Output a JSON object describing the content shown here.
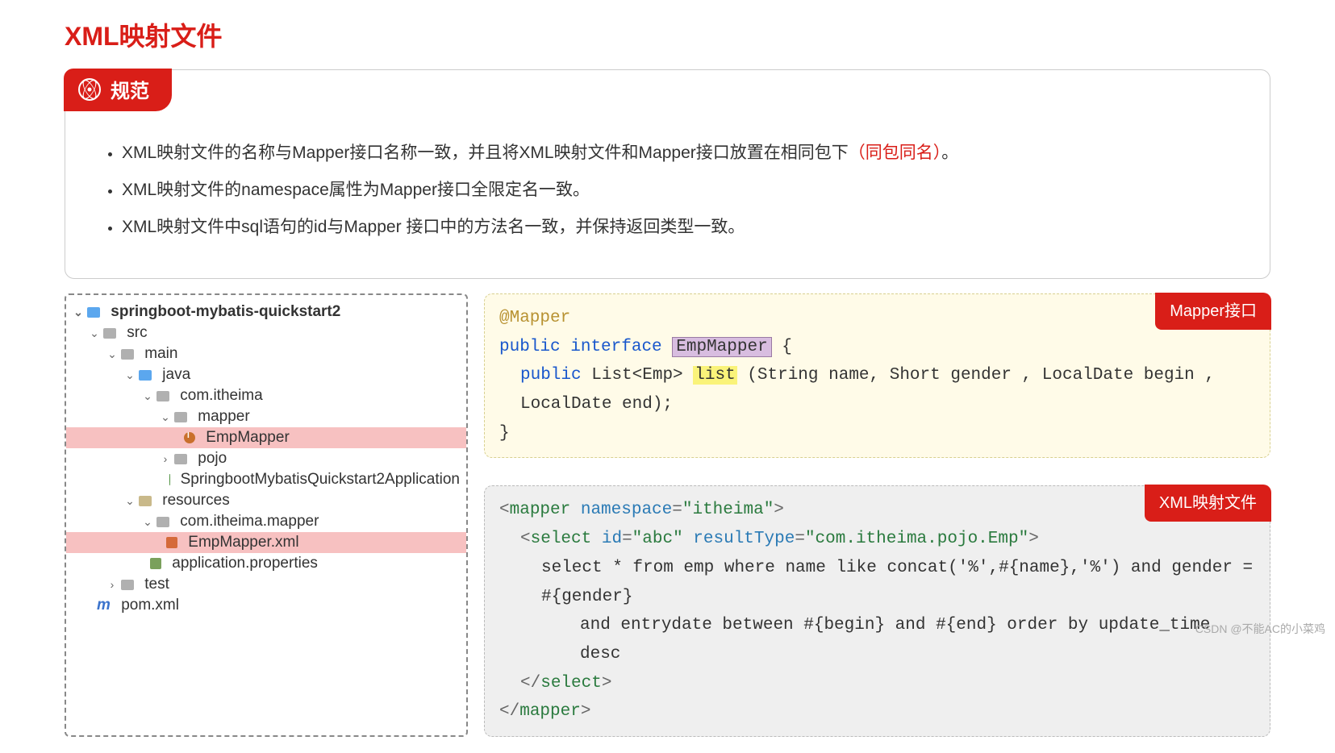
{
  "title": "XML映射文件",
  "badge_label": "规范",
  "rules": [
    {
      "pre": "XML映射文件的名称与Mapper接口名称一致，并且将XML映射文件和Mapper接口放置在相同包下",
      "red": "（同包同名）",
      "post": "。"
    },
    {
      "pre": "XML映射文件的namespace属性为Mapper接口全限定名一致。",
      "red": "",
      "post": ""
    },
    {
      "pre": "XML映射文件中sql语句的id与Mapper 接口中的方法名一致，并保持返回类型一致。",
      "red": "",
      "post": ""
    }
  ],
  "tree": {
    "root": "springboot-mybatis-quickstart2",
    "src": "src",
    "main": "main",
    "java": "java",
    "pkg": "com.itheima",
    "mapper_pkg": "mapper",
    "empMapper": "EmpMapper",
    "pojo": "pojo",
    "app": "SpringbootMybatisQuickstart2Application",
    "resources": "resources",
    "res_pkg": "com.itheima.mapper",
    "empXml": "EmpMapper.xml",
    "props": "application.properties",
    "test": "test",
    "pom": "pom.xml"
  },
  "code1": {
    "tag": "Mapper接口",
    "anno": "@Mapper",
    "kw_public": "public",
    "kw_interface": "interface",
    "cls": "EmpMapper",
    "brace_open": "{",
    "list_type": "List<Emp>",
    "method": "list",
    "params": "(String name, Short gender , LocalDate begin , LocalDate end);",
    "brace_close": "}"
  },
  "code2": {
    "tag": "XML映射文件",
    "mapper_open_1": "<mapper",
    "ns_attr": "namespace",
    "ns_val": "\"itheima\"",
    "close_angle": ">",
    "select_open": "<select",
    "id_attr": "id",
    "id_val": "\"abc\"",
    "rt_attr": "resultType",
    "rt_val": "\"com.itheima.pojo.Emp\"",
    "sql1": "select * from emp where name like concat('%',#{name},'%') and gender = #{gender}",
    "sql2": "and entrydate between #{begin} and #{end} order by update_time desc",
    "select_close": "</select>",
    "mapper_close": "</mapper>"
  },
  "watermark": "CSDN @不能AC的小菜鸡"
}
